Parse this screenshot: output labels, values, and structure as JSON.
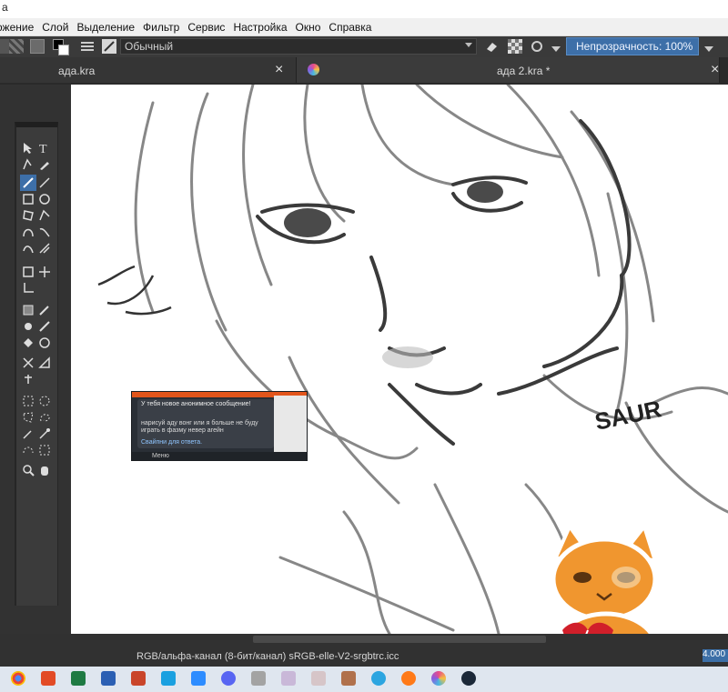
{
  "window": {
    "title_fragment": "a"
  },
  "menu": [
    "ожение",
    "Слой",
    "Выделение",
    "Фильтр",
    "Сервис",
    "Настройка",
    "Окно",
    "Справка"
  ],
  "toolbar": {
    "brush_preset": "Обычный",
    "opacity_label": "Непрозрачность: 100%"
  },
  "tabs": [
    {
      "label": "ада.kra",
      "close": "×"
    },
    {
      "label": "ада 2.kra *",
      "close": "×"
    }
  ],
  "notification": {
    "title": "У тебя новое анонимное сообщение!",
    "body": "нарисуй аду вонг или я больше не буду играть в фазму невер агейн",
    "reply": "Свайпни для ответа.",
    "menu": "Меню"
  },
  "canvas": {
    "signature": "SAUR"
  },
  "status": {
    "colorspace": "RGB/альфа-канал (8-бит/канал)  sRGB-elle-V2-srgbtrc.icc",
    "zoom": "4.000"
  },
  "colors": {
    "accent": "#3d6fa8",
    "panel": "#323232",
    "canvas": "#ffffff"
  }
}
